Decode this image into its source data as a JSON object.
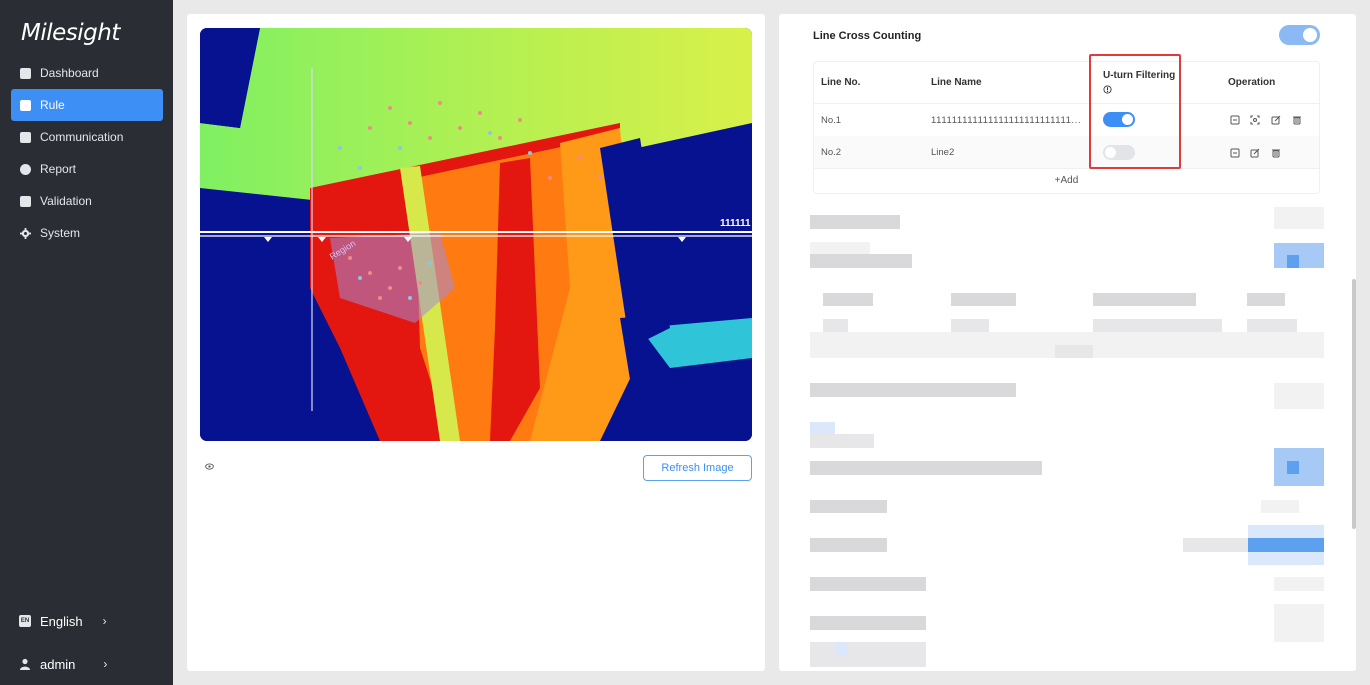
{
  "app": {
    "brand": "Milesight"
  },
  "sidebar": {
    "items": [
      {
        "label": "Dashboard",
        "icon": "dashboard-icon",
        "active": false
      },
      {
        "label": "Rule",
        "icon": "rule-icon",
        "active": true
      },
      {
        "label": "Communication",
        "icon": "communication-icon",
        "active": false
      },
      {
        "label": "Report",
        "icon": "report-icon",
        "active": false
      },
      {
        "label": "Validation",
        "icon": "validation-icon",
        "active": false
      },
      {
        "label": "System",
        "icon": "gear-icon",
        "active": false
      }
    ],
    "language": {
      "label": "English",
      "icon_text": "EN"
    },
    "user": {
      "label": "admin"
    }
  },
  "preview": {
    "line_label": "111111",
    "region_label": "Region",
    "refresh_label": "Refresh Image"
  },
  "line_cross": {
    "title": "Line Cross Counting",
    "enabled": true,
    "columns": [
      "Line No.",
      "Line Name",
      "U-turn Filtering",
      "Operation"
    ],
    "rows": [
      {
        "no": "No.1",
        "name": "111111111111111111111111111...",
        "u_turn": true
      },
      {
        "no": "No.2",
        "name": "Line2",
        "u_turn": false
      }
    ],
    "add_label": "+Add"
  },
  "colors": {
    "accent": "#3d8ef5",
    "sidebar_bg": "#2a2d33",
    "highlight": "#e03b3b"
  }
}
